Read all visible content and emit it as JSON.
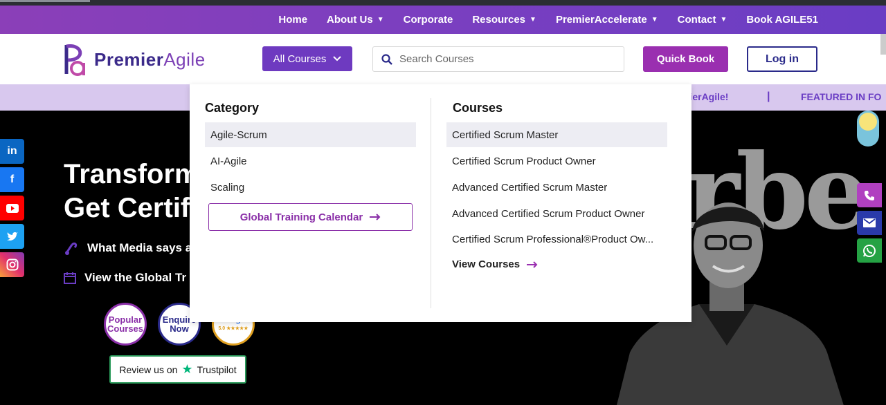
{
  "topnav": {
    "items": [
      {
        "label": "Home",
        "dropdown": false
      },
      {
        "label": "About Us",
        "dropdown": true
      },
      {
        "label": "Corporate",
        "dropdown": false
      },
      {
        "label": "Resources",
        "dropdown": true
      },
      {
        "label": "PremierAccelerate",
        "dropdown": true
      },
      {
        "label": "Contact",
        "dropdown": true
      },
      {
        "label": "Book AGILE51",
        "dropdown": false
      }
    ]
  },
  "header": {
    "logo_text_1": "Premier",
    "logo_text_2": "Agile",
    "all_courses_label": "All Courses",
    "search_placeholder": "Search Courses",
    "quick_book_label": "Quick Book",
    "login_label": "Log in"
  },
  "ticker": {
    "text_1": "mierAgile!",
    "separator": "|",
    "text_2": "FEATURED IN FO"
  },
  "hero": {
    "title_line_1": "Transform",
    "title_line_2": "Get Certif",
    "media_line": "What Media says a",
    "calendar_line": "View the Global Tr",
    "badge_popular": "Popular Courses",
    "badge_enquire": "Enquire Now",
    "badge_google": "Google",
    "badge_google_rating": "5.0 ★★★★★",
    "trustpilot_prefix": "Review us on",
    "trustpilot_brand": "Trustpilot",
    "forbes_text": "rbe"
  },
  "dropdown": {
    "category_title": "Category",
    "categories": [
      "Agile-Scrum",
      "AI-Agile",
      "Scaling"
    ],
    "active_category": "Agile-Scrum",
    "global_calendar_label": "Global Training Calendar",
    "courses_title": "Courses",
    "courses": [
      "Certified Scrum Master",
      "Certified Scrum Product Owner",
      "Advanced Certified Scrum Master",
      "Advanced Certified Scrum Product Owner",
      "Certified Scrum Professional®Product Ow..."
    ],
    "view_courses_label": "View Courses"
  },
  "social": [
    "linkedin-icon",
    "facebook-icon",
    "youtube-icon",
    "twitter-icon",
    "instagram-icon"
  ],
  "colors": {
    "brand_purple": "#6e3ac0",
    "quick_book": "#9a2fb0",
    "login_border": "#2a2a8a"
  }
}
